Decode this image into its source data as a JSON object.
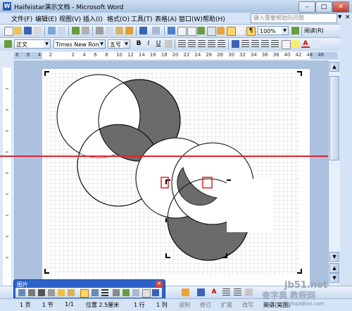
{
  "window": {
    "title": "Haifeistar演示文档 - Microsoft Word",
    "minimize": "–",
    "maximize": "□",
    "close": "✕"
  },
  "menu": {
    "items": [
      "文件(F)",
      "编辑(E)",
      "视图(V)",
      "插入(I)",
      "格式(O)",
      "工具(T)",
      "表格(A)",
      "窗口(W)",
      "帮助(H)"
    ],
    "help_placeholder": "键入需要帮助的问题",
    "help_arrow": "▼",
    "close_doc": "✕"
  },
  "standard_toolbar": {
    "zoom": "100%",
    "reading_label": "阅读(R)"
  },
  "formatting_toolbar": {
    "style": "正文",
    "font": "Times New Roman",
    "size": "五号",
    "bold": "B",
    "italic": "I",
    "underline": "U",
    "font_color_glyph": "A"
  },
  "ruler": {
    "h_ticks": [
      "8",
      "6",
      "4",
      "2",
      "",
      "2",
      "4",
      "6",
      "8",
      "10",
      "12",
      "14",
      "16",
      "18",
      "20",
      "22",
      "24",
      "26",
      "28",
      "30",
      "32",
      "34",
      "36",
      "38",
      "40",
      "42",
      "44",
      "46"
    ]
  },
  "picture_toolbar": {
    "title": "图片",
    "close": "✕"
  },
  "statusbar": {
    "page": "1 页",
    "section": "1 节",
    "pages": "1/1",
    "position": "位置 2.5厘米",
    "line": "1 行",
    "col": "1 列",
    "rec": "录制",
    "trk": "修订",
    "ext": "扩展",
    "ovr": "改写",
    "lang": "英语(美国)"
  },
  "watermark": {
    "line1": "jb51.net",
    "line2": "查字典 教程网",
    "line3": "jiaocheng.chazidian.com"
  },
  "colors": {
    "shade": "#6b6b6b",
    "guide": "#e8202a",
    "selection": "#e8202a"
  }
}
